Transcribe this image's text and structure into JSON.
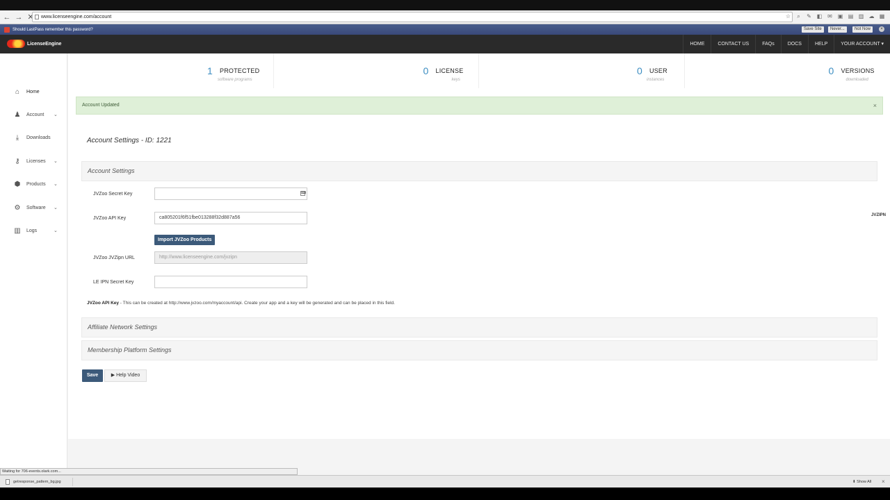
{
  "browser": {
    "url": "www.licenseengine.com/account"
  },
  "lastpass": {
    "message": "Should LastPass remember this password?",
    "save_site": "Save Site",
    "never": "Never...",
    "not_now": "Not Now"
  },
  "header": {
    "logo_text": "LicenseEngine",
    "nav": [
      "HOME",
      "CONTACT US",
      "FAQs",
      "DOCS",
      "HELP",
      "YOUR ACCOUNT ▾"
    ]
  },
  "sidebar": {
    "items": [
      {
        "label": "Home"
      },
      {
        "label": "Account"
      },
      {
        "label": "Downloads"
      },
      {
        "label": "Licenses"
      },
      {
        "label": "Products"
      },
      {
        "label": "Software"
      },
      {
        "label": "Logs"
      }
    ]
  },
  "stats": [
    {
      "value": "1",
      "label": "PROTECTED",
      "sub": "software programs"
    },
    {
      "value": "0",
      "label": "LICENSE",
      "sub": "keys"
    },
    {
      "value": "0",
      "label": "USER",
      "sub": "instances"
    },
    {
      "value": "0",
      "label": "VERSIONS",
      "sub": "downloaded"
    }
  ],
  "alert": {
    "text": "Account Updated",
    "close": "×"
  },
  "page": {
    "title": "Account Settings - ID: 1221"
  },
  "account_settings": {
    "heading": "Account Settings",
    "jvzoo_secret_label": "JVZoo Secret Key",
    "jvzoo_secret_value": "",
    "jvzoo_api_label": "JVZoo API Key",
    "jvzoo_api_value": "ca805201f6f51fbe013288f32d887a56",
    "import_button": "Import JVZoo Products",
    "jvzipn_url_label": "JVZoo JVZipn URL",
    "jvzipn_url_value": "http://www.licenseengine.com/jvzipn",
    "le_ipn_label": "LE IPN Secret Key",
    "le_ipn_value": "",
    "help_bold": "JVZoo API Key",
    "help_text": " - This can be created at http://www.jvzoo.com/myaccount/api. Create your app and a key will be generated and can be placed in this field.",
    "side_tag": "JVZIPN"
  },
  "affiliate": {
    "heading": "Affiliate Network Settings"
  },
  "membership": {
    "heading": "Membership Platform Settings"
  },
  "actions": {
    "save": "Save",
    "help_video": "▶ Help Video"
  },
  "status": {
    "text": "Waiting for 706-events.olark.com..."
  },
  "downloads": {
    "file": "getresponse_pattern_bg.jpg",
    "show_all": "⬇ Show All",
    "close": "×"
  },
  "colors": {
    "accent_blue": "#3d8ec2",
    "button_navy": "#3c5a7a",
    "success_bg": "#dff0d8",
    "header_bg": "#2a2a2a"
  }
}
